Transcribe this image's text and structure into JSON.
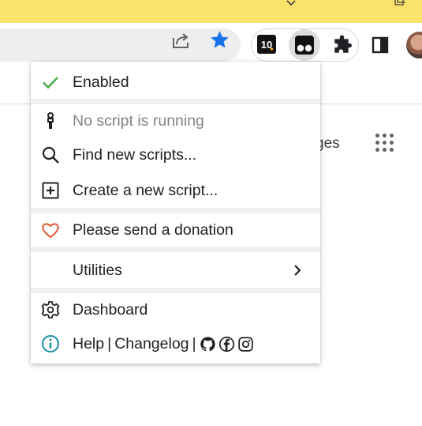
{
  "browser": {
    "accent": "#1a73e8",
    "topbar_color": "#fbe26a",
    "extensions": {
      "ten_label": "10"
    }
  },
  "background_page": {
    "images_link_fragment": "ges"
  },
  "menu": {
    "enabled_label": "Enabled",
    "status_label": "No script is running",
    "find_label": "Find new scripts...",
    "create_label": "Create a new script...",
    "donate_label": "Please send a donation",
    "utilities_label": "Utilities",
    "dashboard_label": "Dashboard",
    "help": {
      "help_label": "Help",
      "separator": "|",
      "changelog_label": "Changelog"
    },
    "colors": {
      "check": "#4caf50",
      "heart": "#e2522f",
      "info": "#1b8fa8"
    },
    "icons": [
      "check-icon",
      "script-status-icon",
      "search-icon",
      "add-box-icon",
      "heart-icon",
      "chevron-right-icon",
      "gear-icon",
      "info-icon",
      "github-icon",
      "facebook-icon",
      "instagram-icon"
    ]
  }
}
